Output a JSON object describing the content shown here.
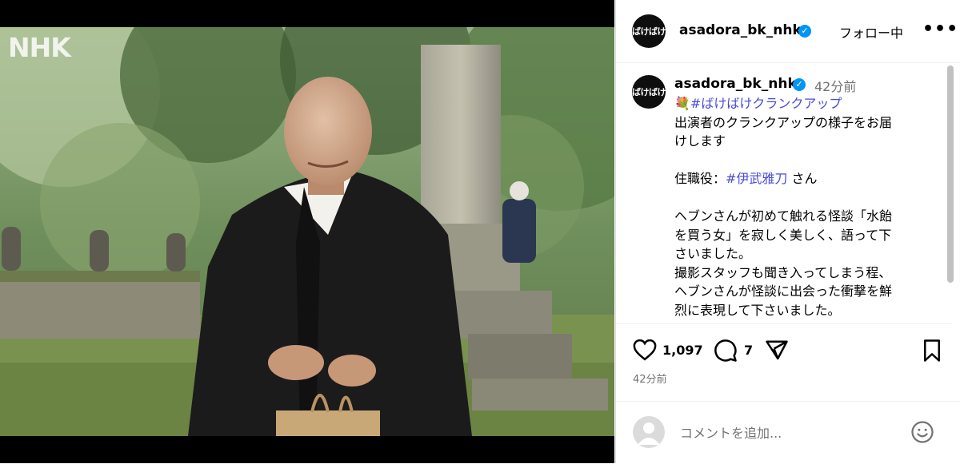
{
  "media": {
    "watermark": "NHK"
  },
  "account": {
    "avatar_text": "ばけばけ",
    "username": "asadora_bk_nhk",
    "follow_label": "フォロー中",
    "more_label": "•••"
  },
  "caption": {
    "username": "asadora_bk_nhk",
    "time": "42分前",
    "lines": [
      "#ばけばけクランクアップ",
      "出演者のクランクアップの様子をお届",
      "けします",
      "",
      "住職役：",
      "#伊武雅刀",
      " さん",
      "ヘブンさんが初めて触れる怪談「水飴",
      "を買う女」を寂しく美しく、語って下",
      "さいました。",
      "撮影スタッフも聞き入ってしまう程、",
      "ヘブンさんが怪談に出会った衝撃を鮮",
      "烈に表現して下さいました。"
    ]
  },
  "stats": {
    "likes": "1,097",
    "comments": "7"
  },
  "post_time": "42分前",
  "comment_box": {
    "placeholder": "コメントを追加..."
  },
  "colors": {
    "accent": "#0095f6",
    "hashtag": "#4a4ad8",
    "muted": "#737373"
  }
}
